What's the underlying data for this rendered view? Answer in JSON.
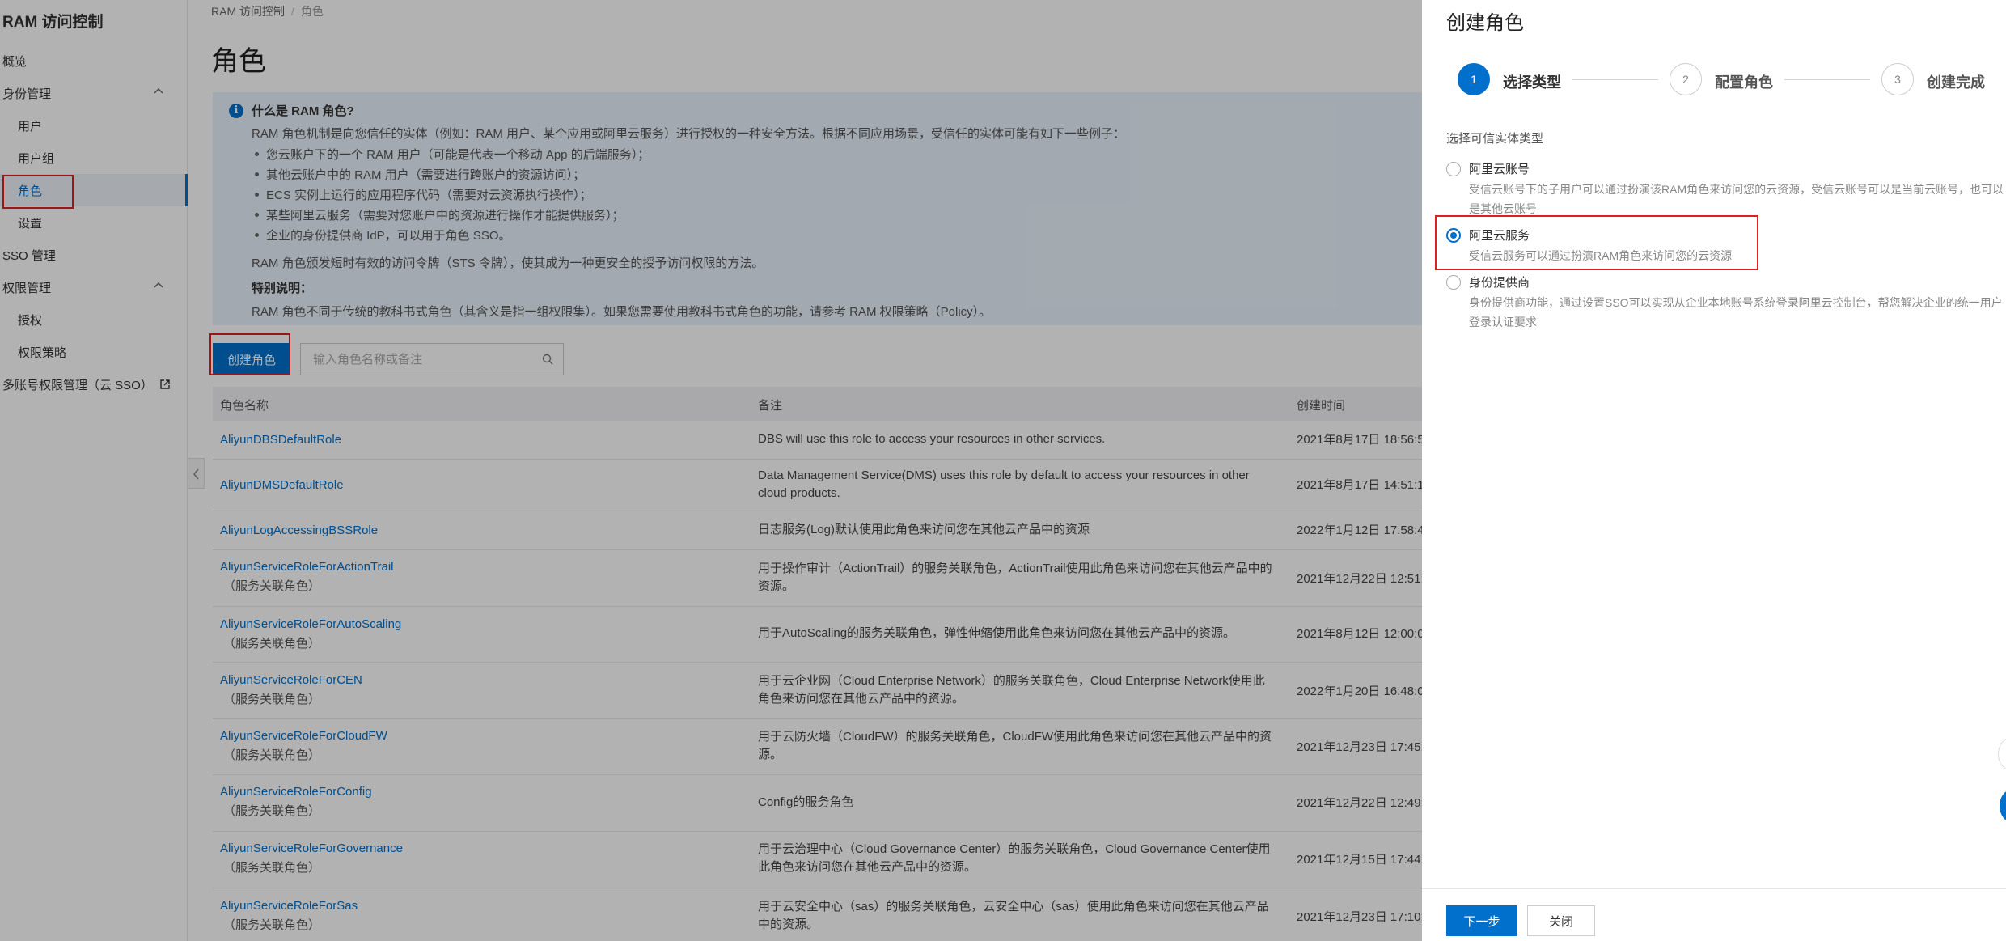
{
  "sidebar": {
    "title": "RAM 访问控制",
    "items": [
      {
        "label": "概览"
      },
      {
        "label": "身份管理"
      },
      {
        "label": "用户"
      },
      {
        "label": "用户组"
      },
      {
        "label": "角色"
      },
      {
        "label": "设置"
      },
      {
        "label": "SSO 管理"
      },
      {
        "label": "权限管理"
      },
      {
        "label": "授权"
      },
      {
        "label": "权限策略"
      },
      {
        "label": "多账号权限管理（云 SSO）"
      }
    ]
  },
  "breadcrumb": {
    "root": "RAM 访问控制",
    "sep": "/",
    "current": "角色"
  },
  "page_title": "角色",
  "info": {
    "icon": "info-icon",
    "title": "什么是 RAM 角色?",
    "intro": "RAM 角色机制是向您信任的实体（例如：RAM 用户、某个应用或阿里云服务）进行授权的一种安全方法。根据不同应用场景，受信任的实体可能有如下一些例子：",
    "bullets": [
      "您云账户下的一个 RAM 用户（可能是代表一个移动 App 的后端服务）；",
      "其他云账户中的 RAM 用户（需要进行跨账户的资源访问）；",
      "ECS 实例上运行的应用程序代码（需要对云资源执行操作）；",
      "某些阿里云服务（需要对您账户中的资源进行操作才能提供服务）；",
      "企业的身份提供商 IdP，可以用于角色 SSO。"
    ],
    "sts": "RAM 角色颁发短时有效的访问令牌（STS 令牌），使其成为一种更安全的授予访问权限的方法。",
    "special_title": "特别说明：",
    "special_text": "RAM 角色不同于传统的教科书式角色（其含义是指一组权限集）。如果您需要使用教科书式角色的功能，请参考 RAM 权限策略（Policy）。"
  },
  "toolbar": {
    "create_label": "创建角色",
    "search_placeholder": "输入角色名称或备注"
  },
  "table": {
    "headers": {
      "name": "角色名称",
      "note": "备注",
      "created": "创建时间"
    },
    "rows": [
      {
        "name": "AliyunDBSDefaultRole",
        "sub": "",
        "note": "DBS will use this role to access your resources in other services.",
        "time": "2021年8月17日 18:56:5"
      },
      {
        "name": "AliyunDMSDefaultRole",
        "sub": "",
        "note": "Data Management Service(DMS) uses this role by default to access your resources in other cloud products.",
        "time": "2021年8月17日 14:51:1"
      },
      {
        "name": "AliyunLogAccessingBSSRole",
        "sub": "",
        "note": "日志服务(Log)默认使用此角色来访问您在其他云产品中的资源",
        "time": "2022年1月12日 17:58:4"
      },
      {
        "name": "AliyunServiceRoleForActionTrail",
        "sub": "（服务关联角色）",
        "note": "用于操作审计（ActionTrail）的服务关联角色，ActionTrail使用此角色来访问您在其他云产品中的资源。",
        "time": "2021年12月22日 12:51:"
      },
      {
        "name": "AliyunServiceRoleForAutoScaling",
        "sub": "（服务关联角色）",
        "note": "用于AutoScaling的服务关联角色，弹性伸缩使用此角色来访问您在其他云产品中的资源。",
        "time": "2021年8月12日 12:00:0"
      },
      {
        "name": "AliyunServiceRoleForCEN",
        "sub": "（服务关联角色）",
        "note": "用于云企业网（Cloud Enterprise Network）的服务关联角色，Cloud Enterprise Network使用此角色来访问您在其他云产品中的资源。",
        "time": "2022年1月20日 16:48:0"
      },
      {
        "name": "AliyunServiceRoleForCloudFW",
        "sub": "（服务关联角色）",
        "note": "用于云防火墙（CloudFW）的服务关联角色，CloudFW使用此角色来访问您在其他云产品中的资源。",
        "time": "2021年12月23日 17:45:"
      },
      {
        "name": "AliyunServiceRoleForConfig",
        "sub": "（服务关联角色）",
        "note": "Config的服务角色",
        "time": "2021年12月22日 12:49:"
      },
      {
        "name": "AliyunServiceRoleForGovernance",
        "sub": "（服务关联角色）",
        "note": "用于云治理中心（Cloud Governance Center）的服务关联角色，Cloud Governance Center使用此角色来访问您在其他云产品中的资源。",
        "time": "2021年12月15日 17:44:"
      },
      {
        "name": "AliyunServiceRoleForSas",
        "sub": "（服务关联角色）",
        "note": "用于云安全中心（sas）的服务关联角色，云安全中心（sas）使用此角色来访问您在其他云产品中的资源。",
        "time": "2021年12月23日 17:10:"
      }
    ]
  },
  "drawer": {
    "title": "创建角色",
    "steps": [
      {
        "num": "1",
        "label": "选择类型",
        "active": true
      },
      {
        "num": "2",
        "label": "配置角色",
        "active": false
      },
      {
        "num": "3",
        "label": "创建完成",
        "active": false
      }
    ],
    "section_label": "选择可信实体类型",
    "options": [
      {
        "title": "阿里云账号",
        "desc": "受信云账号下的子用户可以通过扮演该RAM角色来访问您的云资源，受信云账号可以是当前云账号，也可以是其他云账号",
        "checked": false
      },
      {
        "title": "阿里云服务",
        "desc": "受信云服务可以通过扮演RAM角色来访问您的云资源",
        "checked": true
      },
      {
        "title": "身份提供商",
        "desc": "身份提供商功能，通过设置SSO可以实现从企业本地账号系统登录阿里云控制台，帮您解决企业的统一用户登录认证要求",
        "checked": false
      }
    ],
    "next_label": "下一步",
    "close_label": "关闭"
  },
  "colors": {
    "accent": "#0070cc",
    "highlight_border": "#e02020"
  }
}
